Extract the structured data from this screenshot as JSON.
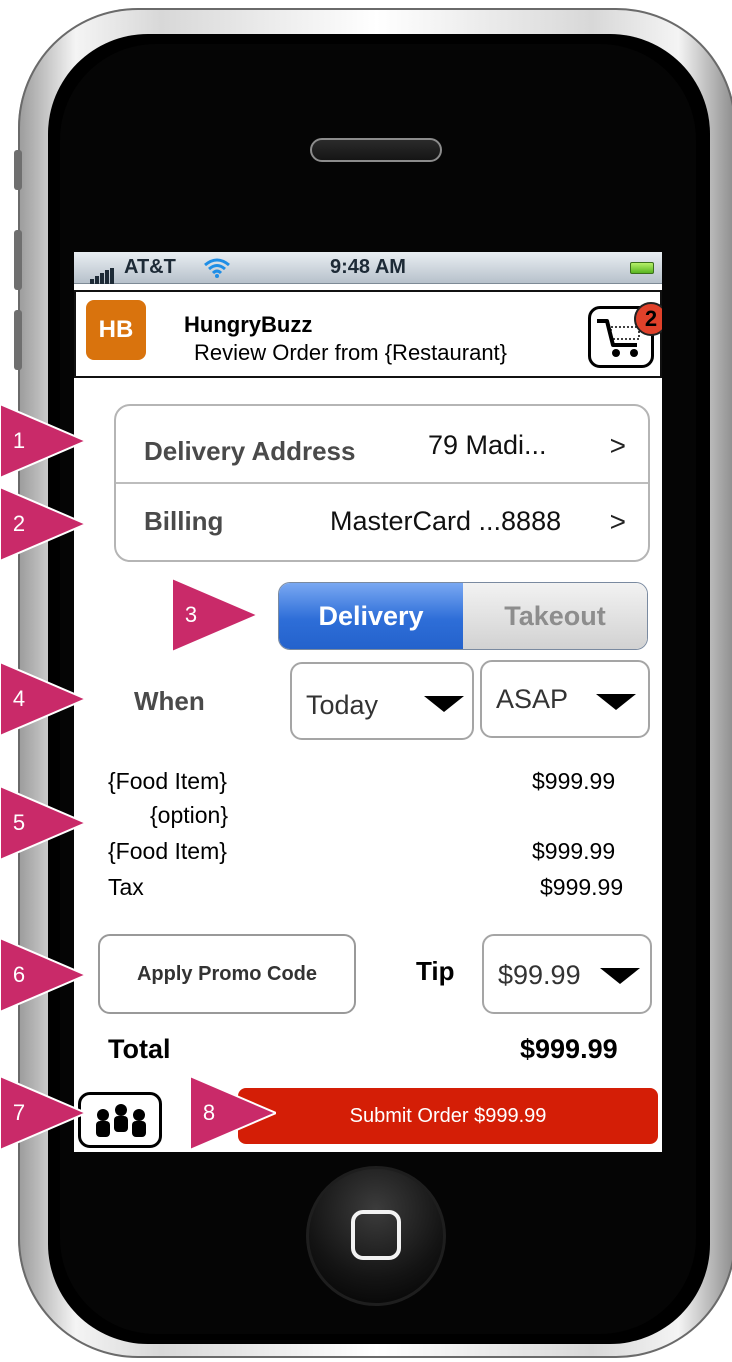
{
  "status_bar": {
    "carrier": "AT&T",
    "time": "9:48 AM"
  },
  "header": {
    "logo_text": "HB",
    "app_name": "HungryBuzz",
    "subtitle": "Review Order from {Restaurant}",
    "cart_count": "2"
  },
  "address_table": {
    "delivery_label": "Delivery Address",
    "delivery_value": "79 Madi...",
    "billing_label": "Billing",
    "billing_value": "MasterCard ...8888",
    "chevron": ">"
  },
  "order_type": {
    "delivery_label": "Delivery",
    "takeout_label": "Takeout",
    "selected": "Delivery"
  },
  "when": {
    "label": "When",
    "day_value": "Today",
    "time_value": "ASAP"
  },
  "line_items": [
    {
      "name": "{Food Item}",
      "price": "$999.99"
    },
    {
      "name": "{option}"
    },
    {
      "name": "{Food Item}",
      "price": "$999.99"
    },
    {
      "name": "Tax",
      "price": "$999.99"
    }
  ],
  "promo": {
    "button_label": "Apply Promo Code"
  },
  "tip": {
    "label": "Tip",
    "value": "$99.99"
  },
  "total": {
    "label": "Total",
    "value": "$999.99"
  },
  "submit": {
    "label": "Submit Order $999.99"
  },
  "annotations": [
    "1",
    "2",
    "3",
    "4",
    "5",
    "6",
    "7",
    "8"
  ],
  "colors": {
    "annotation_marker": "#c92a69",
    "submit_button": "#d41e06",
    "segment_active": "#2e6ed8",
    "logo": "#d9730d",
    "cart_badge": "#e0412a"
  }
}
